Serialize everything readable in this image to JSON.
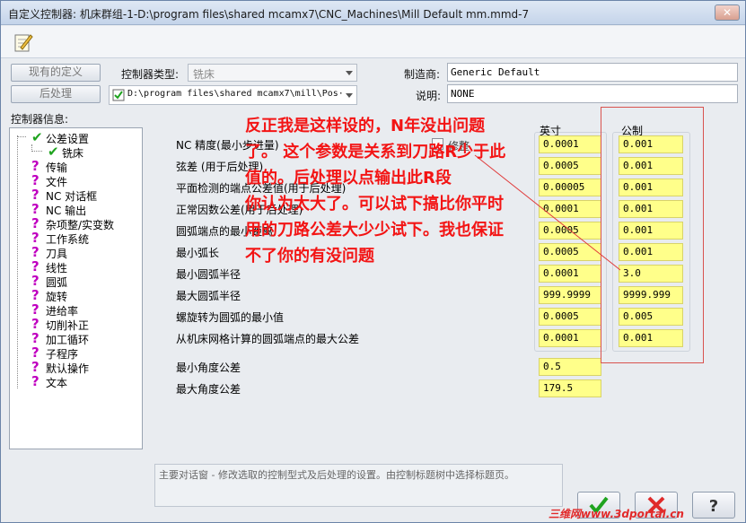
{
  "window": {
    "title": "自定义控制器: 机床群组-1-D:\\program files\\shared mcamx7\\CNC_Machines\\Mill Default mm.mmd-7",
    "close_glyph": "✕"
  },
  "top": {
    "existing_btn": "现有的定义",
    "post_btn": "后处理",
    "controller_type_label": "控制器类型:",
    "controller_type_value": "铣床",
    "post_path": "D:\\program files\\shared mcamx7\\mill\\Pos·",
    "manufacturer_label": "制造商:",
    "manufacturer_value": "Generic Default",
    "description_label": "说明:",
    "description_value": "NONE",
    "controller_info_label": "控制器信息:"
  },
  "tree": [
    {
      "label": "公差设置",
      "icon": "check"
    },
    {
      "label": "铣床",
      "icon": "check"
    },
    {
      "label": "传输",
      "icon": "question"
    },
    {
      "label": "文件",
      "icon": "question"
    },
    {
      "label": "NC 对话框",
      "icon": "question"
    },
    {
      "label": "NC 输出",
      "icon": "question"
    },
    {
      "label": "杂项整/实变数",
      "icon": "question"
    },
    {
      "label": "工作系统",
      "icon": "question"
    },
    {
      "label": "刀具",
      "icon": "question"
    },
    {
      "label": "线性",
      "icon": "question"
    },
    {
      "label": "圆弧",
      "icon": "question"
    },
    {
      "label": "旋转",
      "icon": "question"
    },
    {
      "label": "进给率",
      "icon": "question"
    },
    {
      "label": "切削补正",
      "icon": "question"
    },
    {
      "label": "加工循环",
      "icon": "question"
    },
    {
      "label": "子程序",
      "icon": "question"
    },
    {
      "label": "默认操作",
      "icon": "question"
    },
    {
      "label": "文本",
      "icon": "question"
    }
  ],
  "columns": {
    "inch": "英寸",
    "metric": "公制",
    "modify": "修整"
  },
  "params": [
    {
      "label": "NC 精度(最小步进量)",
      "inch": "0.0001",
      "metric": "0.001"
    },
    {
      "label": "弦差 (用于后处理)",
      "inch": "0.0005",
      "metric": "0.001"
    },
    {
      "label": "平面检测的端点公差值(用于后处理)",
      "inch": "0.00005",
      "metric": "0.001"
    },
    {
      "label": "正常因数公差(用于后处理)",
      "inch": "0.0001",
      "metric": "0.001"
    },
    {
      "label": "圆弧端点的最小距离",
      "inch": "0.0005",
      "metric": "0.001"
    },
    {
      "label": "最小弧长",
      "inch": "0.0005",
      "metric": "0.001"
    },
    {
      "label": "最小圆弧半径",
      "inch": "0.0001",
      "metric": "3.0"
    },
    {
      "label": "最大圆弧半径",
      "inch": "999.9999",
      "metric": "9999.999"
    },
    {
      "label": "螺旋转为圆弧的最小值",
      "inch": "0.0005",
      "metric": "0.005"
    },
    {
      "label": "从机床网格计算的圆弧端点的最大公差",
      "inch": "0.0001",
      "metric": "0.001"
    }
  ],
  "angles": [
    {
      "label": "最小角度公差",
      "value": "0.5"
    },
    {
      "label": "最大角度公差",
      "value": "179.5"
    }
  ],
  "annotation": [
    "反正我是这样设的，N年没出问题",
    "了。 这个参数是关系到刀路R少于此",
    "值的。后处理以点输出此R段",
    "你认为太大了。可以试下搞比你平时",
    "用的刀路公差大少少试下。我也保证",
    "不了你的有没问题"
  ],
  "status_text": "主要对话窗 - 修改选取的控制型式及后处理的设置。由控制标题树中选择标题页。",
  "watermark": "三维网www.3dportal.cn",
  "colors": {
    "annotation": "#f31414",
    "field": "#ffff8a",
    "check": "#1fa31f",
    "question": "#c000c0"
  }
}
